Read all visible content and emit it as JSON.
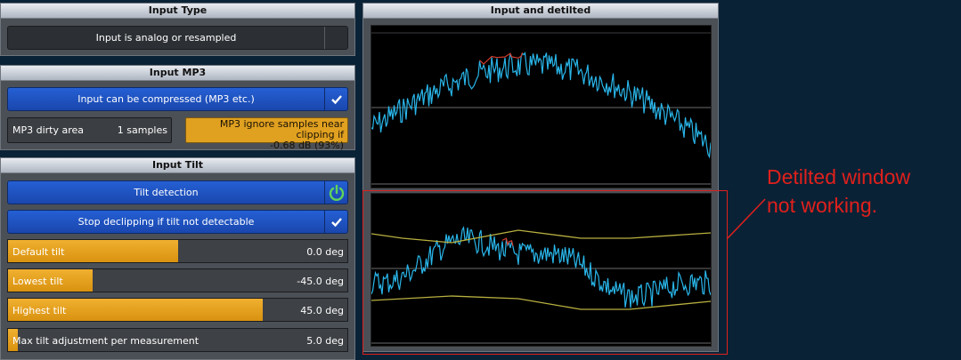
{
  "input_type": {
    "header": "Input Type",
    "mode_label": "Input is analog or resampled"
  },
  "input_mp3": {
    "header": "Input MP3",
    "compressed_label": "Input can be compressed (MP3 etc.)",
    "dirty_area_label": "MP3 dirty area",
    "dirty_area_value": "1 samples",
    "ignore_clip_line1": "MP3 ignore samples near clipping if",
    "ignore_clip_line2": "-0.68 dB (93%)"
  },
  "input_tilt": {
    "header": "Input Tilt",
    "tilt_detection_label": "Tilt detection",
    "stop_declip_label": "Stop declipping if tilt not detectable",
    "sliders": [
      {
        "label": "Default tilt",
        "value": "0.0 deg",
        "fill": 0.5
      },
      {
        "label": "Lowest tilt",
        "value": "-45.0 deg",
        "fill": 0.25
      },
      {
        "label": "Highest tilt",
        "value": "45.0 deg",
        "fill": 0.75
      },
      {
        "label": "Max tilt adjustment per measurement",
        "value": "5.0 deg",
        "fill": 0.03
      }
    ]
  },
  "scope_panel": {
    "header": "Input and detilted"
  },
  "annotation": {
    "line1": "Detilted window",
    "line2": "not working."
  },
  "colors": {
    "accent_blue": "#2560d4",
    "accent_orange": "#e0a020",
    "waveform": "#29b6ea",
    "envelope": "#b8b040",
    "annotation_red": "#e0201c",
    "power_icon": "#5fd35a"
  }
}
